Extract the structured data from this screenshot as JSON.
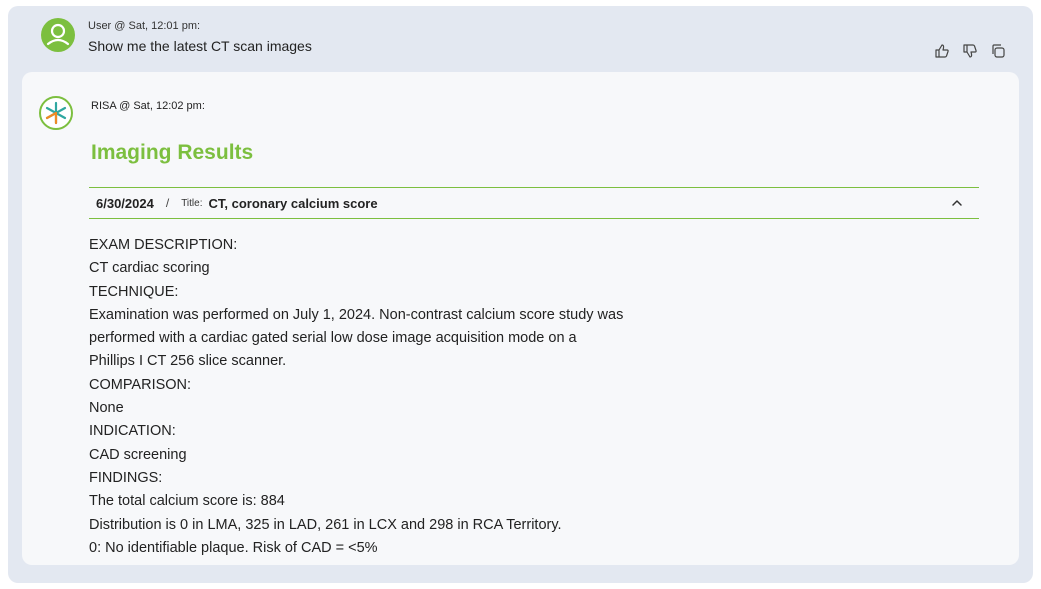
{
  "user_message": {
    "meta": "User @ Sat, 12:01 pm:",
    "text": "Show me the latest CT scan images",
    "avatar_icon": "user-avatar-icon"
  },
  "message_actions": [
    {
      "name": "thumbs-up-icon"
    },
    {
      "name": "thumbs-down-icon"
    },
    {
      "name": "copy-icon"
    }
  ],
  "assistant_message": {
    "meta": "RISA @ Sat, 12:02 pm:",
    "avatar_icon": "risa-logo-icon",
    "section_title": "Imaging Results",
    "result": {
      "date": "6/30/2024",
      "separator": "/",
      "title_label": "Title:",
      "title": "CT, coronary calcium score",
      "expanded": true
    },
    "report_lines": [
      "EXAM DESCRIPTION:",
      "CT cardiac scoring",
      "TECHNIQUE:",
      "Examination was performed on July 1, 2024. Non-contrast calcium score study was",
      "performed with a cardiac gated serial low dose image acquisition mode on a",
      "Phillips I CT 256 slice scanner.",
      "COMPARISON:",
      "None",
      "INDICATION:",
      "CAD screening",
      "FINDINGS:",
      "The total calcium score is: 884",
      "Distribution is 0 in LMA, 325 in LAD, 261 in LCX and 298 in RCA Territory.",
      "0: No identifiable plaque. Risk of CAD = <5%"
    ]
  },
  "colors": {
    "accent_green": "#7cbf3f",
    "outer_background": "#e3e8f1",
    "card_background": "#f7f8fa"
  }
}
